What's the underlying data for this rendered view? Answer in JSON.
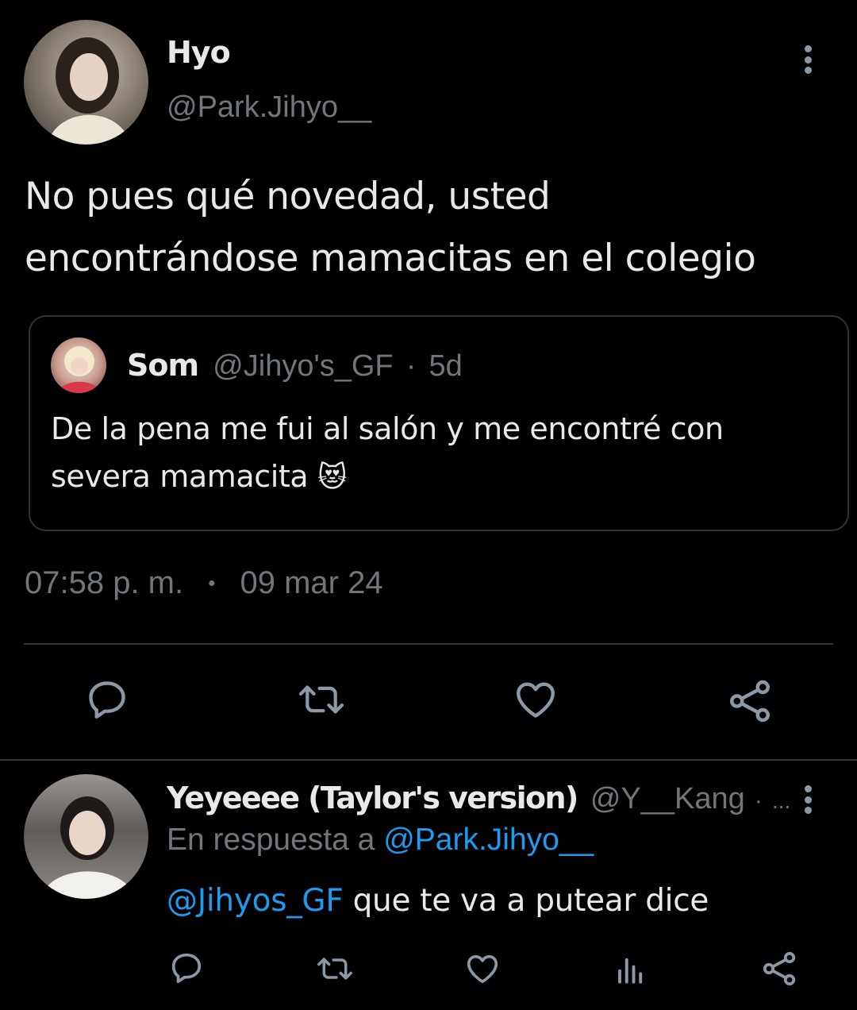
{
  "tweet": {
    "author": {
      "name": "Hyo",
      "handle": "@Park.Jihyo__"
    },
    "text_line1": "No pues qué novedad, usted",
    "text_line2": "encontrándose mamacitas en el colegio",
    "quote": {
      "name": "Som",
      "handle": "@Jihyo's_GF",
      "separator": "·",
      "age": "5d",
      "text_line1": "De la pena me fui al salón y me encontré con",
      "text_line2": "severa mamacita",
      "emoji": "😻"
    },
    "time": "07:58 p. m.",
    "dot": "•",
    "date": "09 mar 24"
  },
  "reply": {
    "name": "Yeyeeee (Taylor's version)",
    "handle": "@Y__Kang",
    "separator": "·",
    "ellipsis": "...",
    "reply_prefix": "En respuesta a",
    "reply_to": "@Park.Jihyo__",
    "mention": "@Jihyos_GF",
    "text": "que te va a putear dice"
  },
  "icons": {
    "more": "more-vertical-icon",
    "reply": "comment-icon",
    "retweet": "retweet-icon",
    "like": "heart-icon",
    "share": "share-icon",
    "views": "views-icon"
  },
  "colors": {
    "background": "#000000",
    "text": "#e7e9ea",
    "muted": "#71767b",
    "link": "#1d9bf0",
    "border": "#2f3336"
  }
}
